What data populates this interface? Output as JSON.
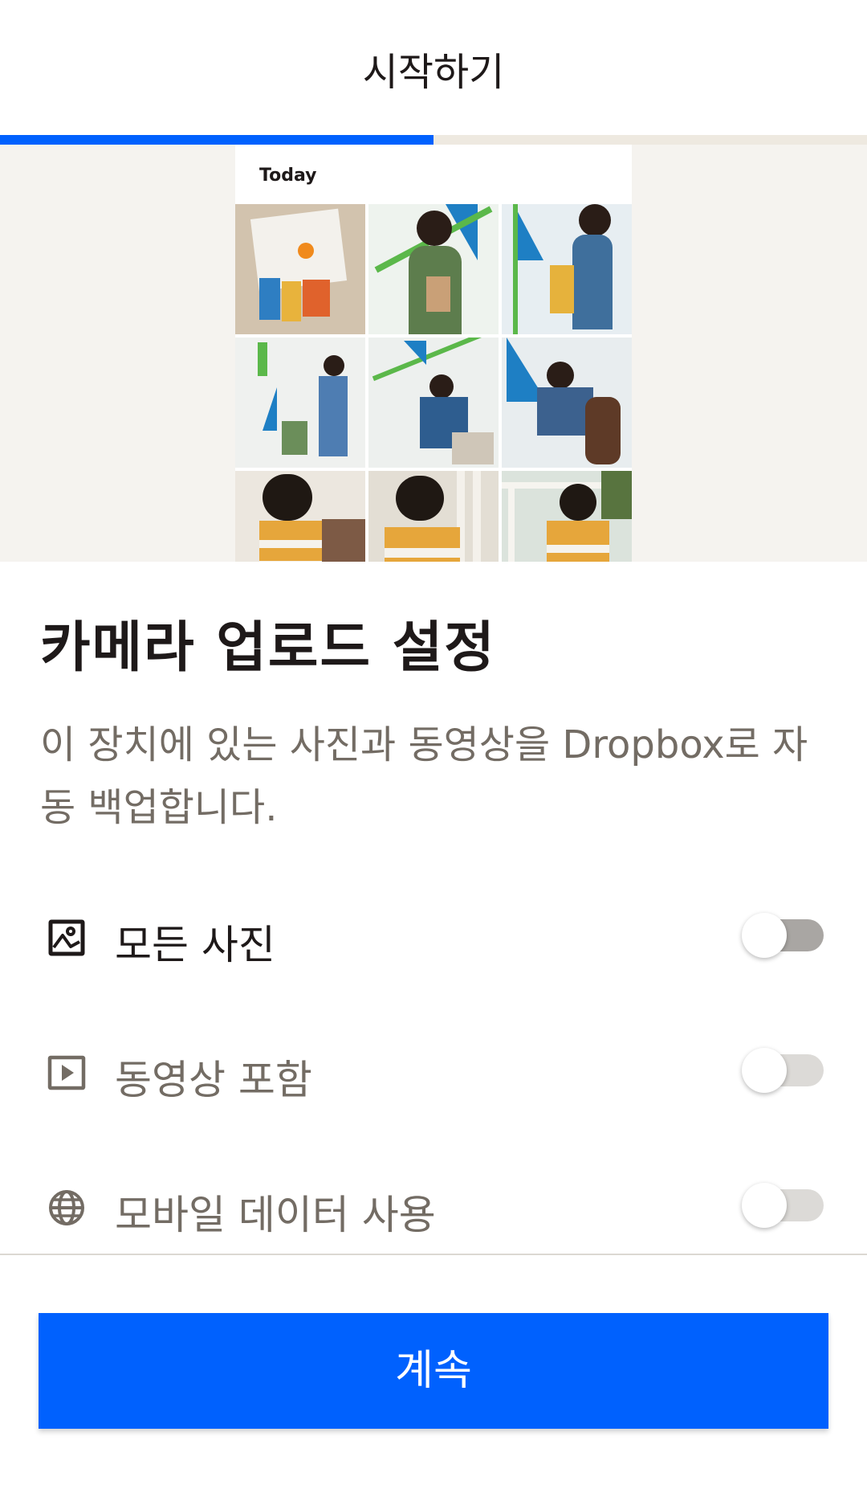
{
  "header": {
    "title": "시작하기"
  },
  "progress": {
    "fraction": 0.5
  },
  "hero": {
    "album_label": "Today",
    "photo_count": 9
  },
  "main": {
    "title": "카메라 업로드 설정",
    "description": "이 장치에 있는 사진과 동영상을 Dropbox로 자동 백업합니다."
  },
  "settings": [
    {
      "icon": "image-icon",
      "label": "모든 사진",
      "enabled": false
    },
    {
      "icon": "video-icon",
      "label": "동영상 포함",
      "enabled": false
    },
    {
      "icon": "globe-icon",
      "label": "모바일 데이터 사용",
      "enabled": false
    }
  ],
  "footer": {
    "continue_label": "계속"
  },
  "colors": {
    "accent": "#0061fe",
    "progress_track": "#eee9e0",
    "hero_background": "#f5f3ef",
    "text_primary": "#1e1919",
    "text_secondary": "#736c64",
    "toggle_track_active_row": "#a9a6a3",
    "toggle_track_inactive_row": "#dcdad7"
  }
}
